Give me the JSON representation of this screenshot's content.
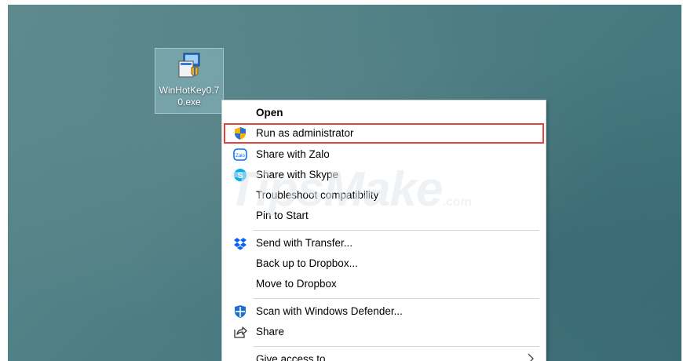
{
  "desktop": {
    "file_icon": {
      "label": "WinHotKey0.70.exe",
      "icon": "installer-icon"
    }
  },
  "watermark": {
    "brand": "TipsMake",
    "suffix": ".com"
  },
  "context_menu": {
    "highlight_color": "#e0443c",
    "items": [
      {
        "label": "Open",
        "icon": "",
        "bold": true
      },
      {
        "label": "Run as administrator",
        "icon": "uac-shield-icon",
        "highlighted": true
      },
      {
        "label": "Share with Zalo",
        "icon": "zalo-icon"
      },
      {
        "label": "Share with Skype",
        "icon": "skype-icon"
      },
      {
        "label": "Troubleshoot compatibility",
        "icon": ""
      },
      {
        "label": "Pin to Start",
        "icon": ""
      },
      {
        "label": "Send with Transfer...",
        "icon": "dropbox-icon"
      },
      {
        "label": "Back up to Dropbox...",
        "icon": ""
      },
      {
        "label": "Move to Dropbox",
        "icon": ""
      },
      {
        "label": "Scan with Windows Defender...",
        "icon": "windows-defender-icon"
      },
      {
        "label": "Share",
        "icon": "share-icon"
      },
      {
        "label": "Give access to",
        "icon": "",
        "submenu": true
      }
    ]
  }
}
